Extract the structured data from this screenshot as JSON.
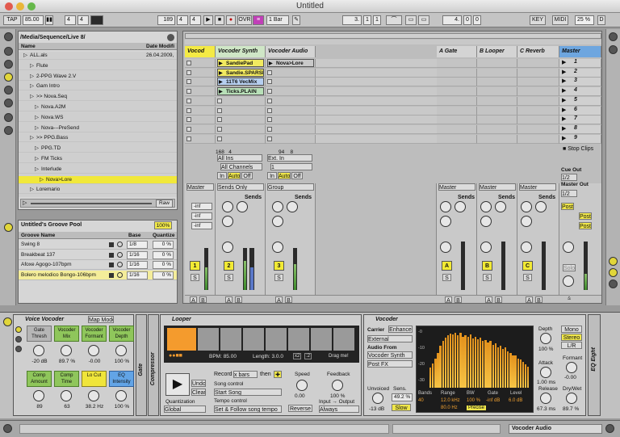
{
  "window": {
    "title": "Untitled"
  },
  "transport": {
    "tap": "TAP",
    "tempo": "85.00",
    "sig_num": "4",
    "sig_den": "4",
    "bar_pos": "189",
    "beat": "4",
    "sub": "4",
    "ovr": "OVR",
    "quant": "1 Bar",
    "loop_start": "3.",
    "loop_beat": "1",
    "loop_sub": "1",
    "loop_len": "4.",
    "loop_len_b": "0",
    "loop_len_c": "0",
    "key": "KEY",
    "midi": "MIDI",
    "cpu": "25 %"
  },
  "browser": {
    "path": "/Media/Sequence/Live 8/",
    "col_name": "Name",
    "col_date": "Date Modifi",
    "items": [
      {
        "name": "ALL.als",
        "date": "26.04.2009,"
      },
      {
        "name": "Flute",
        "date": ""
      },
      {
        "name": "2-PPG Wave 2.V",
        "date": ""
      },
      {
        "name": "Gam Intro",
        "date": ""
      },
      {
        "name": ">> Nova.Seq",
        "date": ""
      },
      {
        "name": "Nova.A2M",
        "date": ""
      },
      {
        "name": "Nova.WS",
        "date": ""
      },
      {
        "name": "Nova---PreSend",
        "date": ""
      },
      {
        "name": ">> PPG.Bass",
        "date": ""
      },
      {
        "name": "PPG.TD",
        "date": ""
      },
      {
        "name": "FM Ticks",
        "date": ""
      },
      {
        "name": "Interlude",
        "date": ""
      },
      {
        "name": "Nova>Lore",
        "date": ""
      },
      {
        "name": "Loremario",
        "date": ""
      }
    ],
    "raw": "Raw"
  },
  "groove": {
    "title": "Untitled's Groove Pool",
    "pct": "100%",
    "col_name": "Groove Name",
    "col_base": "Base",
    "col_quant": "Quantize",
    "rows": [
      {
        "name": "Swing 8",
        "base": "1/8",
        "q": "0 %"
      },
      {
        "name": "Breakbeat 137",
        "base": "1/16",
        "q": "0 %"
      },
      {
        "name": "Afoxe Agogo-107bpm",
        "base": "1/16",
        "q": "0 %"
      },
      {
        "name": "Bolero melodico Bongo-106bpm",
        "base": "1/16",
        "q": "0 %"
      }
    ]
  },
  "tracks": [
    {
      "name": "Vocod",
      "color": "#f4ea44"
    },
    {
      "name": "Vocoder Synth",
      "color": "#cfe6c6"
    },
    {
      "name": "Vocoder Audio",
      "color": "#d4d4d4"
    },
    {
      "name": "A Gate",
      "color": "#d4d4d4"
    },
    {
      "name": "B Looper",
      "color": "#d4d4d4"
    },
    {
      "name": "C Reverb",
      "color": "#d4d4d4"
    },
    {
      "name": "Master",
      "color": "#6ea6df"
    }
  ],
  "clips_synth": [
    "SandiePad",
    "Sandie.SPARSE",
    "11T6 VecMix",
    "Ticks.PLAIN"
  ],
  "clips_audio": [
    "Nova>Lore"
  ],
  "scenes": [
    "1",
    "2",
    "3",
    "4",
    "5",
    "6",
    "7",
    "8",
    "9"
  ],
  "stop_clips": "Stop Clips",
  "io": {
    "synth_in": "All Ins",
    "synth_ch": "All Channels",
    "audio_in": "Ext. In",
    "audio_ch": "1",
    "in": "In",
    "auto": "Auto",
    "off": "Off",
    "master": "Master",
    "sends_only": "Sends Only",
    "group": "Group",
    "cue_out": "Cue Out",
    "cue_val": "1/2",
    "master_out": "Master Out",
    "master_val": "1/2"
  },
  "mixer": {
    "sends": "Sends",
    "inf": "-inf",
    "vol_synth": "168",
    "pan_synth": "4",
    "vol_audio": "94",
    "pan_audio": "8",
    "solo": "Solo",
    "post": "Post",
    "a": "A",
    "b": "B",
    "c": "C",
    "s": "S",
    "n1": "1",
    "n2": "2",
    "n3": "3"
  },
  "voice_vocoder": {
    "title": "Voice Vocoder",
    "map": "Map Mode",
    "btns": [
      {
        "l": "Gate Thresh",
        "v": "-20 dB",
        "c": "gray"
      },
      {
        "l": "Vocoder Mix",
        "v": "89.7 %",
        "c": "green"
      },
      {
        "l": "Vocoder Formant",
        "v": "-0.00",
        "c": "green"
      },
      {
        "l": "Vocoder Depth",
        "v": "100 %",
        "c": "green"
      },
      {
        "l": "Comp Amount",
        "v": "89",
        "c": "green"
      },
      {
        "l": "Comp Time",
        "v": "63",
        "c": "green"
      },
      {
        "l": "Lo Cut",
        "v": "38.2 Hz",
        "c": "yel"
      },
      {
        "l": "EQ Intensity",
        "v": "100 %",
        "c": "blue"
      }
    ]
  },
  "side": {
    "gate": "Gate",
    "compressor": "Compressor"
  },
  "looper": {
    "title": "Looper",
    "bpm": "BPM: 85.00",
    "length": "Length: 3.0.0",
    "x2": "x2",
    "div2": ":2",
    "drag": "Drag me!",
    "undo": "Undo",
    "clear": "Clear",
    "record": "Record",
    "bars": "x bars",
    "then": "then",
    "song": "Song control",
    "song_val": "Start Song",
    "tempo": "Tempo control",
    "tempo_val": "Set & Follow song tempo",
    "speed": "Speed",
    "speed_v": "0.00",
    "reverse": "Reverse",
    "feedback": "Feedback",
    "feedback_v": "100 %",
    "io": "Input → Output",
    "always": "Always",
    "quant": "Quantization",
    "global": "Global"
  },
  "vocoder": {
    "title": "Vocoder",
    "carrier": "Carrier",
    "enhance": "Enhance",
    "external": "External",
    "audio_from": "Audio From",
    "af_val": "Vocoder Synth",
    "post": "Post FX",
    "unvoiced": "Unvoiced",
    "unvoiced_v": "-13 dB",
    "sens": "Sens.",
    "sens_v": "49.2 %",
    "slow": "Slow",
    "bands": "Bands",
    "bands_v": "40",
    "range": "Range",
    "range_v": "12.0 kHz",
    "range_v2": "80.0 Hz",
    "bw": "BW",
    "bw_v": "100 %",
    "gate": "Gate",
    "gate_v": "-inf dB",
    "level": "Level",
    "level_v": "6.0 dB",
    "precise": "Precise",
    "depth": "Depth",
    "depth_v": "100 %",
    "mono": "Mono",
    "stereo": "Stereo",
    "lr": "L/R",
    "attack": "Attack",
    "attack_v": "1.00 ms",
    "formant": "Formant",
    "formant_v": "-0.00",
    "release": "Release",
    "release_v": "67.3 ms",
    "drywet": "Dry/Wet",
    "drywet_v": "89.7 %",
    "eq": "EQ Eight",
    "axis": [
      "-0",
      "-10",
      "-20",
      "-30"
    ],
    "bars": [
      0.35,
      0.42,
      0.5,
      0.6,
      0.72,
      0.8,
      0.86,
      0.9,
      0.93,
      0.92,
      0.94,
      0.9,
      0.95,
      0.88,
      0.9,
      0.87,
      0.92,
      0.85,
      0.88,
      0.84,
      0.86,
      0.8,
      0.82,
      0.78,
      0.8,
      0.74,
      0.76,
      0.7,
      0.72,
      0.66,
      0.7,
      0.62,
      0.6,
      0.56,
      0.55,
      0.5,
      0.48,
      0.44,
      0.4,
      0.36
    ]
  },
  "status": {
    "track": "Vocoder Audio"
  }
}
